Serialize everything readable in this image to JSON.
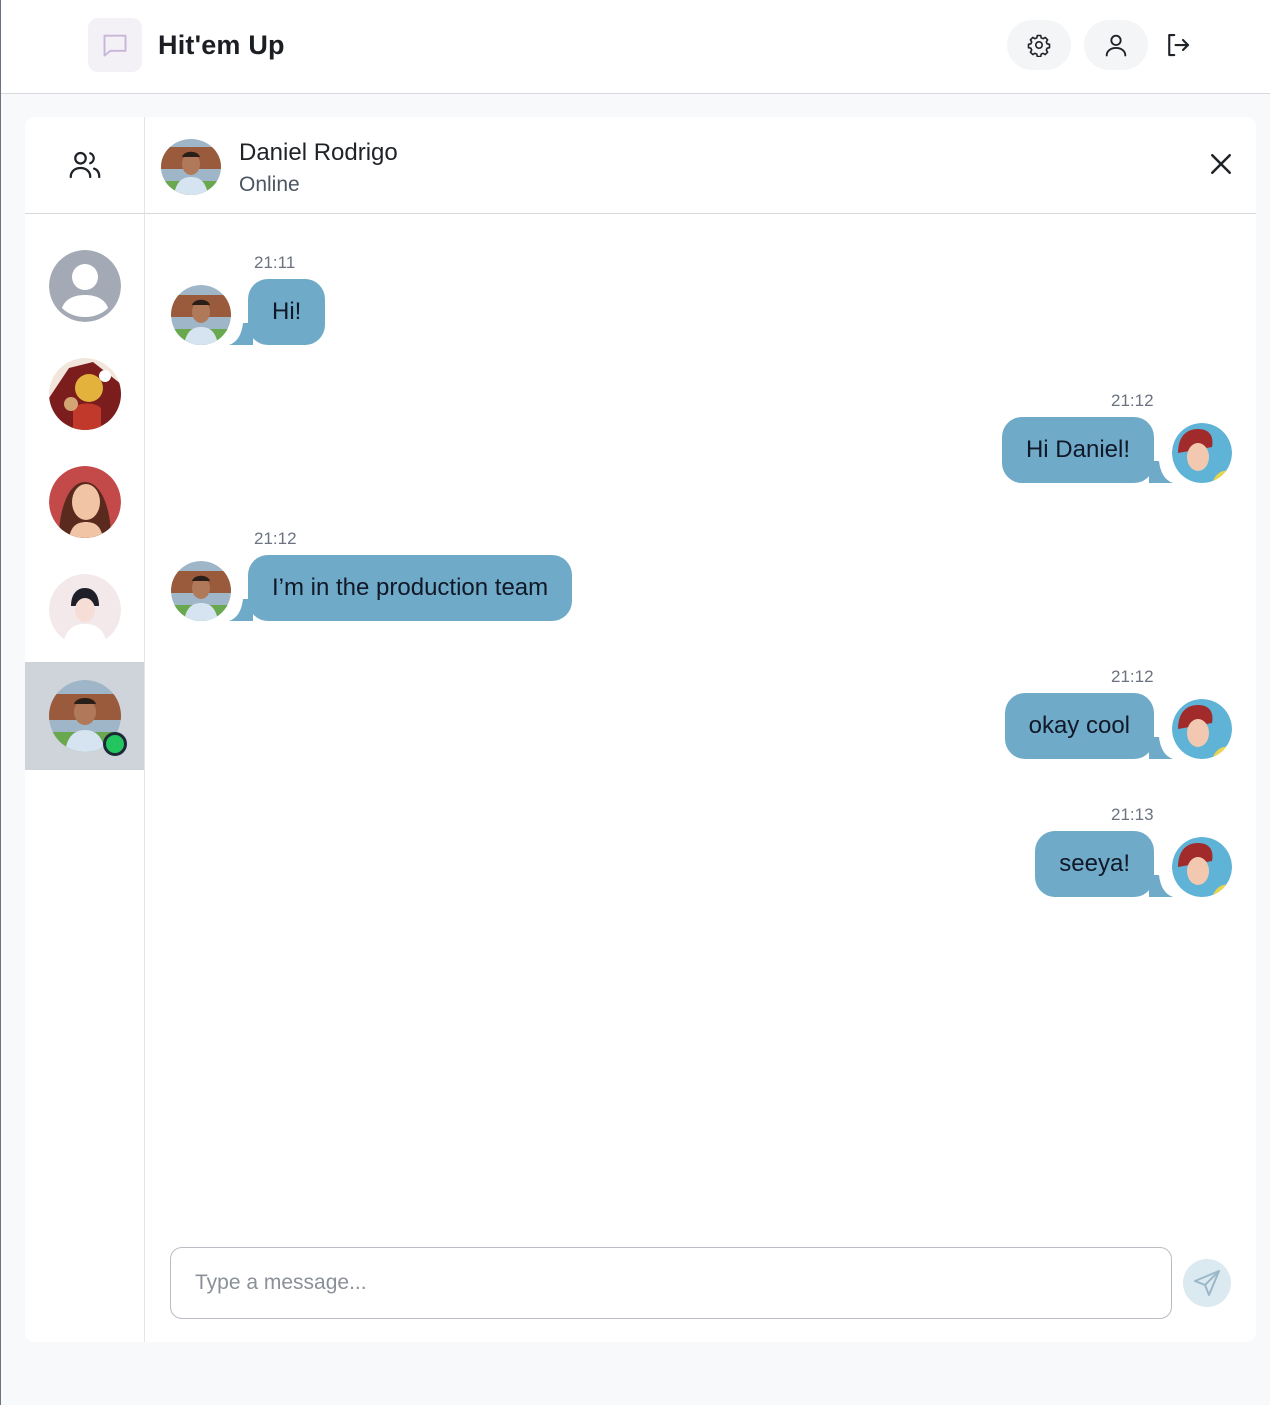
{
  "app": {
    "title": "Hit'em Up",
    "logo_icon": "chat-bubble-icon"
  },
  "header_actions": [
    {
      "icon": "gear-icon",
      "label": "Settings"
    },
    {
      "icon": "user-icon",
      "label": "Profile"
    },
    {
      "icon": "logout-icon",
      "label": "Log out"
    }
  ],
  "sidebar": {
    "header_icon": "users-icon",
    "contacts": [
      {
        "avatar": "default-avatar",
        "active": false,
        "online": false
      },
      {
        "avatar": "photo-goddess",
        "active": false,
        "online": false
      },
      {
        "avatar": "photo-woman-brunette",
        "active": false,
        "online": false
      },
      {
        "avatar": "photo-woman-white",
        "active": false,
        "online": false
      },
      {
        "avatar": "photo-daniel",
        "active": true,
        "online": true
      }
    ]
  },
  "chat": {
    "contact_name": "Daniel Rodrigo",
    "contact_status": "Online",
    "messages": [
      {
        "side": "left",
        "time": "21:11",
        "text": "Hi!"
      },
      {
        "side": "right",
        "time": "21:12",
        "text": "Hi Daniel!"
      },
      {
        "side": "left",
        "time": "21:12",
        "text": "I’m in the production team"
      },
      {
        "side": "right",
        "time": "21:12",
        "text": "okay cool"
      },
      {
        "side": "right",
        "time": "21:13",
        "text": "seeya!"
      }
    ]
  },
  "composer": {
    "placeholder": "Type a message...",
    "value": "",
    "send_icon": "send-icon"
  },
  "colors": {
    "bubble": "#6faac8",
    "online": "#22c55e",
    "active_contact_bg": "#cfd3da"
  }
}
